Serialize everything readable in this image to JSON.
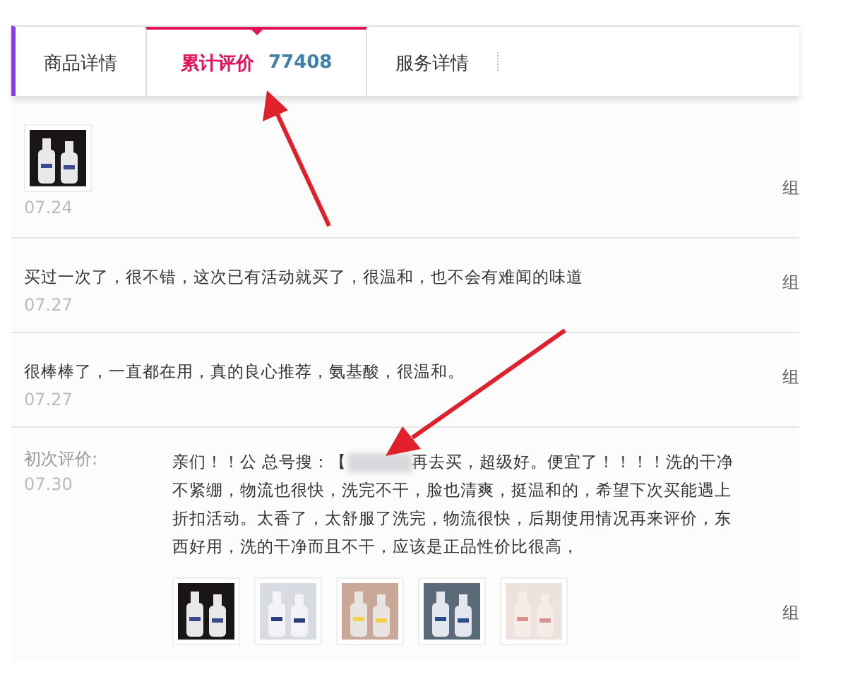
{
  "tabs": [
    {
      "label": "商品详情",
      "selected": false
    },
    {
      "label": "累计评价",
      "count": "77408",
      "selected": true
    },
    {
      "label": "服务详情",
      "selected": false
    }
  ],
  "reviews": [
    {
      "date": "07.24",
      "photos": [
        {
          "kind": "picture"
        }
      ],
      "side": "组"
    },
    {
      "segments": [
        {
          "kind": "text",
          "text": "买过一次了，很不错，这次已有活动就买了，很温和，也不会有难闻的味道"
        }
      ],
      "date": "07.27",
      "side": "组"
    },
    {
      "segments": [
        {
          "kind": "text",
          "text": "很棒棒了，一直都在用，真的良心推荐，氨基酸，很温和。"
        }
      ],
      "date": "07.27",
      "side": "组"
    },
    {
      "label": "初次评价:",
      "segments": [
        {
          "kind": "text",
          "text": "亲们！！公 总号搜：【"
        },
        {
          "kind": "redacted"
        },
        {
          "kind": "text",
          "text": "再去买，超级好。便宜了！！！！洗的干净不紧绷，物流也很快，洗完不干，脸也清爽，挺温和的，希望下次买能遇上折扣活动。太香了，太舒服了洗完，物流很快，后期使用情况再来评价，东西好用，洗的干净而且不干，应该是正品性价比很高，"
        }
      ],
      "date": "07.30",
      "photos": [
        {
          "kind": "picture"
        },
        {
          "kind": "picture"
        },
        {
          "kind": "picture"
        },
        {
          "kind": "picture"
        },
        {
          "kind": "picture"
        }
      ],
      "side": "组"
    }
  ]
}
